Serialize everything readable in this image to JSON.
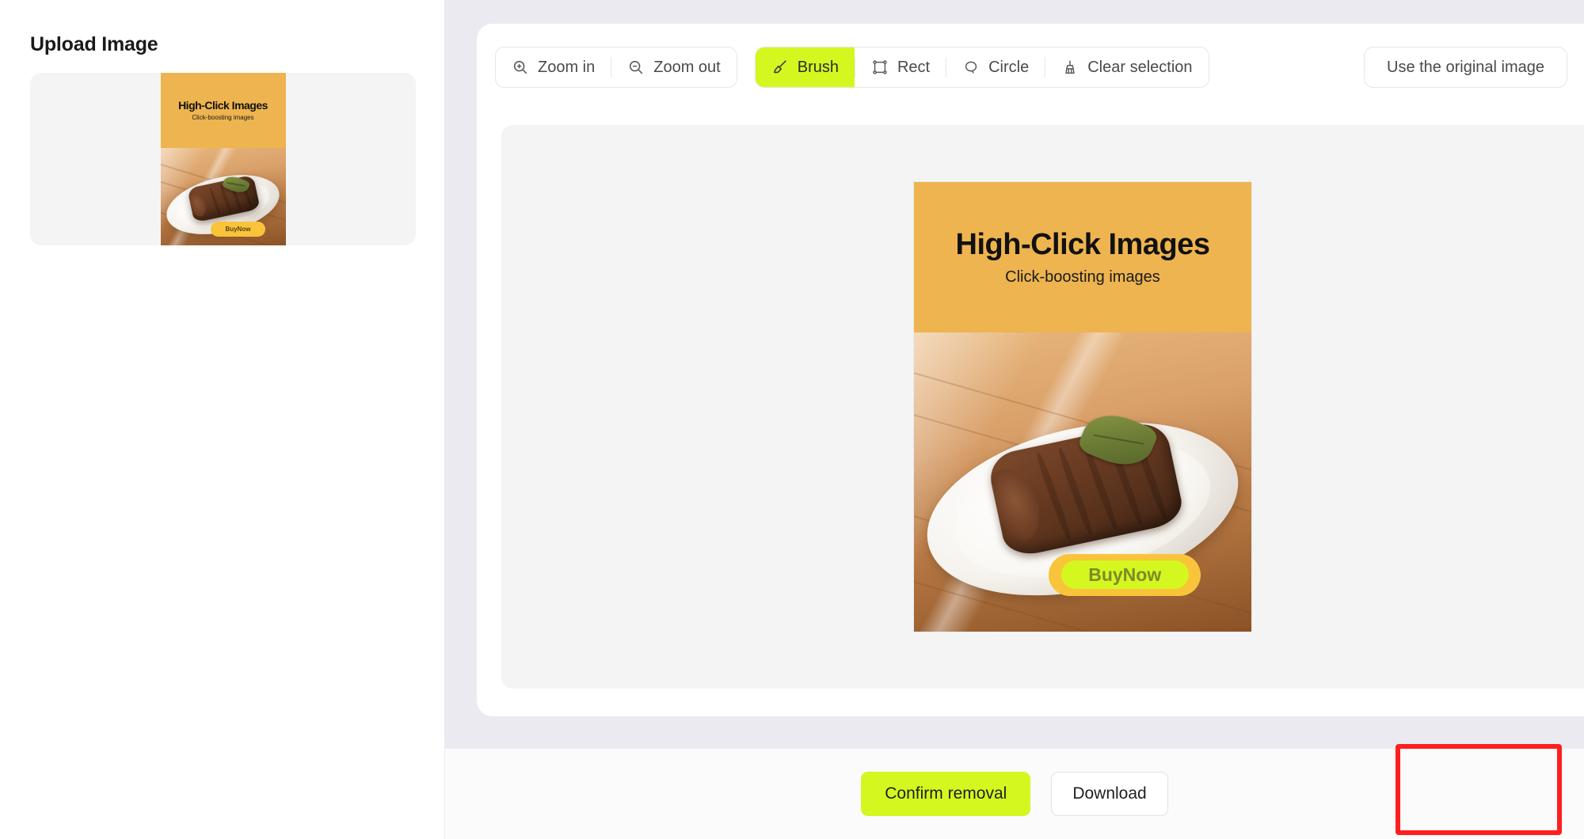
{
  "sidebar": {
    "title": "Upload Image",
    "thumbnail_name": "uploaded-image-thumbnail"
  },
  "toolbar": {
    "zoom_group": [
      {
        "label": "Zoom in",
        "icon": "zoom-in-icon",
        "active": false
      },
      {
        "label": "Zoom out",
        "icon": "zoom-out-icon",
        "active": false
      }
    ],
    "tool_group": [
      {
        "label": "Brush",
        "icon": "brush-icon",
        "active": true
      },
      {
        "label": "Rect",
        "icon": "rect-icon",
        "active": false
      },
      {
        "label": "Circle",
        "icon": "circle-icon",
        "active": false
      },
      {
        "label": "Clear selection",
        "icon": "broom-icon",
        "active": false
      }
    ],
    "original_image_label": "Use the original image"
  },
  "creative": {
    "headline": "High-Click Images",
    "subhead": "Click-boosting images",
    "cta_label": "BuyNow",
    "banner_color": "#eeb44f",
    "cta_color": "#f9c43a",
    "selection_mask_color": "#d4f720"
  },
  "bottom": {
    "confirm_label": "Confirm removal",
    "download_label": "Download",
    "highlight_color": "#ff1f1f"
  },
  "colors": {
    "accent": "#d4f720",
    "main_bg": "#eceaf1",
    "canvas_bg": "#f4f4f5"
  }
}
